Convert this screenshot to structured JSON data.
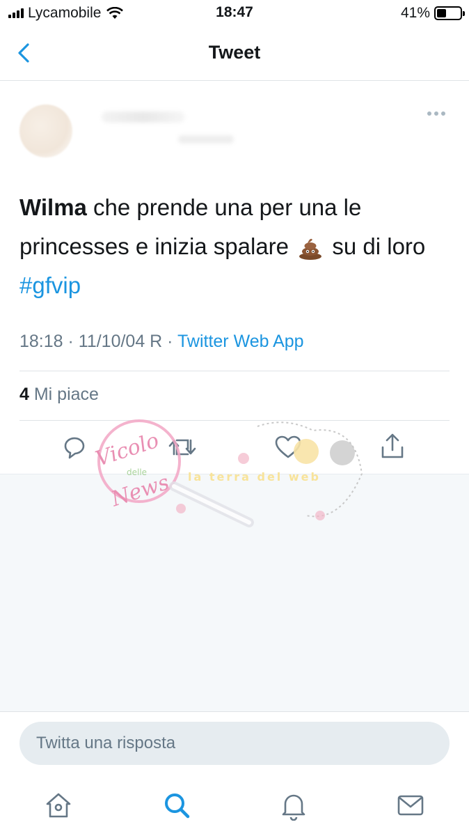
{
  "status_bar": {
    "carrier": "Lycamobile",
    "time": "18:47",
    "battery_percent": "41%",
    "battery_level": 0.41
  },
  "nav": {
    "title": "Tweet"
  },
  "tweet": {
    "text_name": "Wilma",
    "text_part1": " che prende una per una le princesses e inizia spalare",
    "text_part2": " su di loro ",
    "hashtag": "#gfvip",
    "timestamp": "18:18 · 11/10/04 R · ",
    "source": "Twitter Web App",
    "likes_count": "4",
    "likes_label": " Mi piace"
  },
  "composer": {
    "placeholder": "Twitta una risposta"
  },
  "watermark": {
    "text_primary": "Vicolo",
    "text_secondary": "delle",
    "text_tertiary": "News",
    "text_banner": "la terra del web"
  },
  "colors": {
    "accent": "#1b95e0",
    "muted": "#657786",
    "text": "#14171a",
    "watermark_pink": "#f2a6c4"
  }
}
